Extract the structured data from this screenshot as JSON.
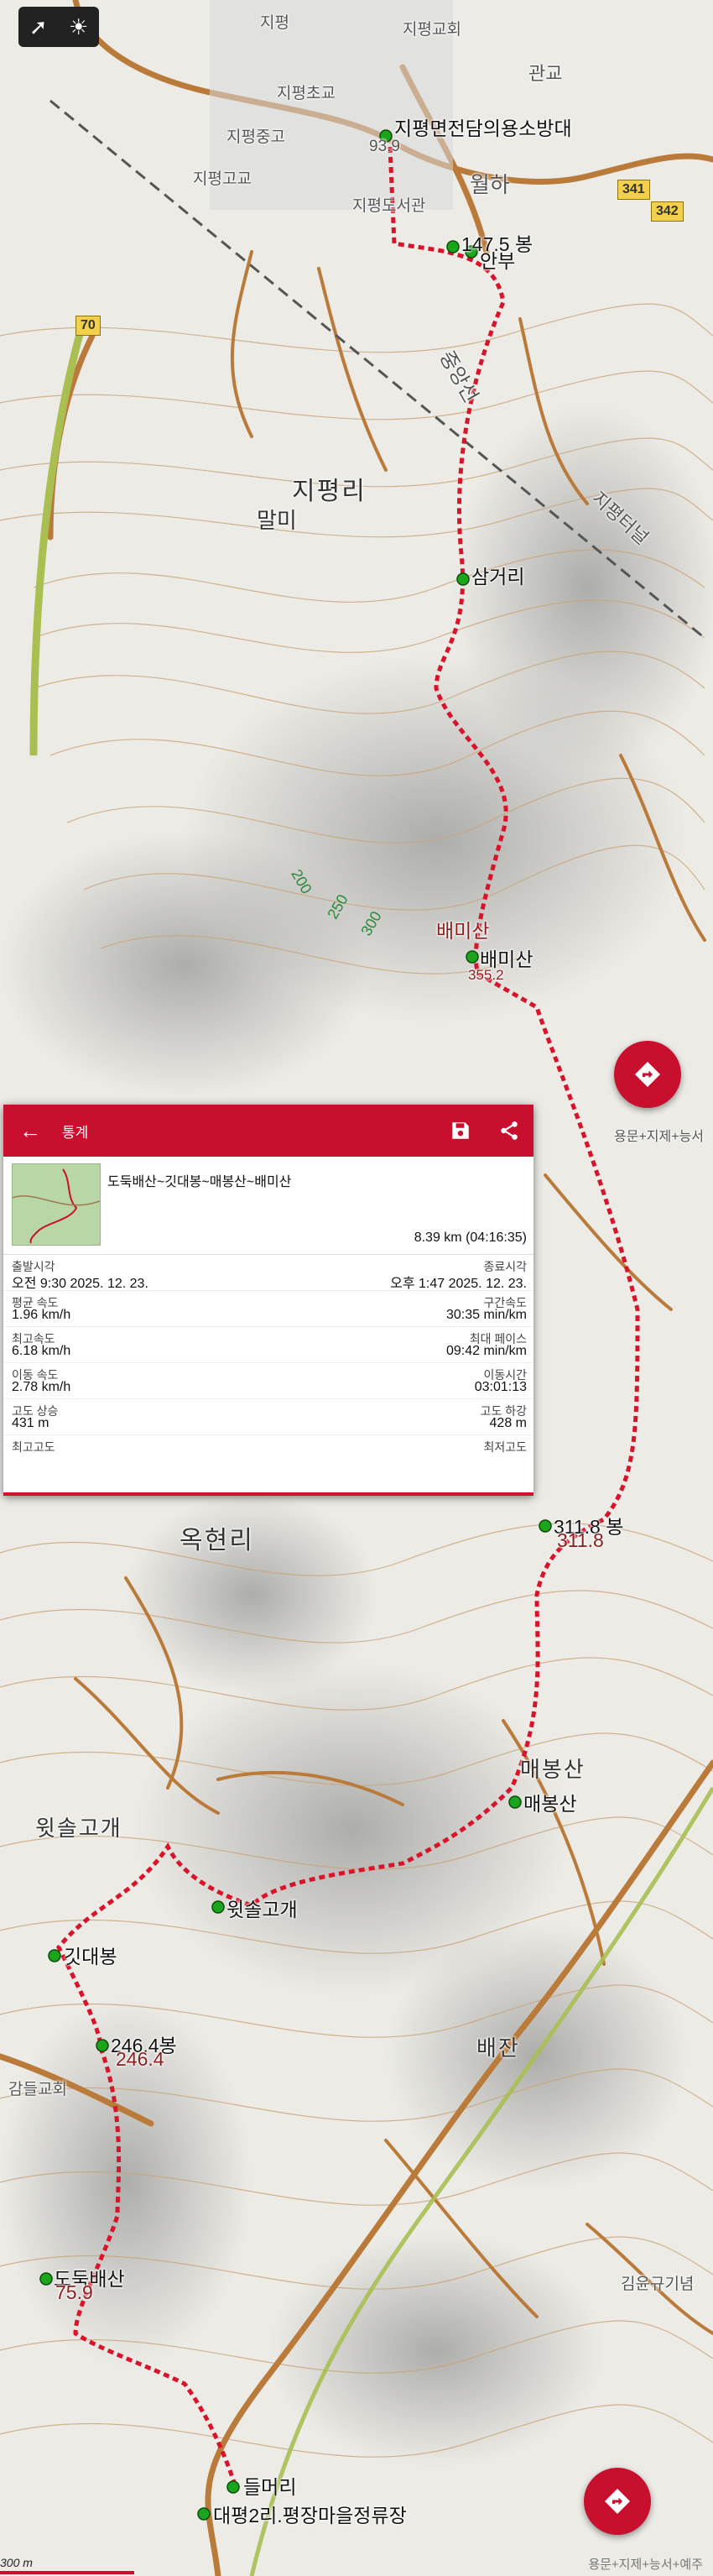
{
  "map": {
    "places": [
      "지평리",
      "옥현리",
      "배잔",
      "말미",
      "관교",
      "월하",
      "감들교회",
      "김윤규기념",
      "지평교회",
      "지평고교",
      "지평중고",
      "지평초교",
      "지평도서관",
      "지평"
    ],
    "railway": "중앙선",
    "tunnel": "지평터널",
    "road_badges": [
      "70",
      "341",
      "342"
    ],
    "town_label": "지평면전담의용소방대",
    "town_elev": "93.9",
    "contours": [
      "200",
      "250",
      "300"
    ],
    "waypoints": [
      {
        "label": "147.5 봉",
        "name": "147.5봉"
      },
      {
        "label": "안부",
        "name": "안부"
      },
      {
        "label": "삼거리",
        "name": "삼거리"
      },
      {
        "label": "배미산",
        "name": "배미산"
      },
      {
        "label": "311.8 봉",
        "name": "311.8봉"
      },
      {
        "label": "매봉산",
        "name": "매봉산"
      },
      {
        "label": "윗솔고개",
        "name": "윗솔고개"
      },
      {
        "label": "깃대봉",
        "name": "깃대봉"
      },
      {
        "label": "246.4봉",
        "name": "246.4봉"
      },
      {
        "label": "도둑배산",
        "name": "도둑배산"
      },
      {
        "label": "들머리",
        "name": "들머리"
      },
      {
        "label": "대평2리.평장마을정류장",
        "name": "대평2리정류장"
      }
    ],
    "peak_labels": [
      "배미산",
      "매봉산",
      "윗솔고개",
      "311.8",
      "246.4",
      "75.9",
      "355.2"
    ],
    "side_label": "용문+지제+능서",
    "scale": "300 m",
    "attribution": "용문+지제+능서+예주",
    "colors": {
      "track": "#d9142a",
      "accent": "#c8102e",
      "road": "#b97a3a",
      "contour": "#c9a478"
    }
  },
  "panel": {
    "title": "통계",
    "back_icon": "back-arrow-icon",
    "save_icon": "save-icon",
    "share_icon": "share-icon",
    "track_name": "도둑배산~깃대봉~매봉산~배미산",
    "distance": "8.39 km (04:16:35)",
    "stats": [
      {
        "left_label": "출발시각",
        "left_value": "오전 9:30 2025. 12. 23.",
        "right_label": "종료시각",
        "right_value": "오후 1:47 2025. 12. 23."
      },
      {
        "left_label": "평균 속도",
        "left_value": "1.96 km/h",
        "right_label": "구간속도",
        "right_value": "30:35 min/km"
      },
      {
        "left_label": "최고속도",
        "left_value": "6.18 km/h",
        "right_label": "최대 페이스",
        "right_value": "09:42 min/km"
      },
      {
        "left_label": "이동 속도",
        "left_value": "2.78 km/h",
        "right_label": "이동시간",
        "right_value": "03:01:13"
      },
      {
        "left_label": "고도 상승",
        "left_value": "431 m",
        "right_label": "고도 하강",
        "right_value": "428 m"
      },
      {
        "left_label": "최고고도",
        "left_value": "",
        "right_label": "최저고도",
        "right_value": ""
      }
    ]
  }
}
